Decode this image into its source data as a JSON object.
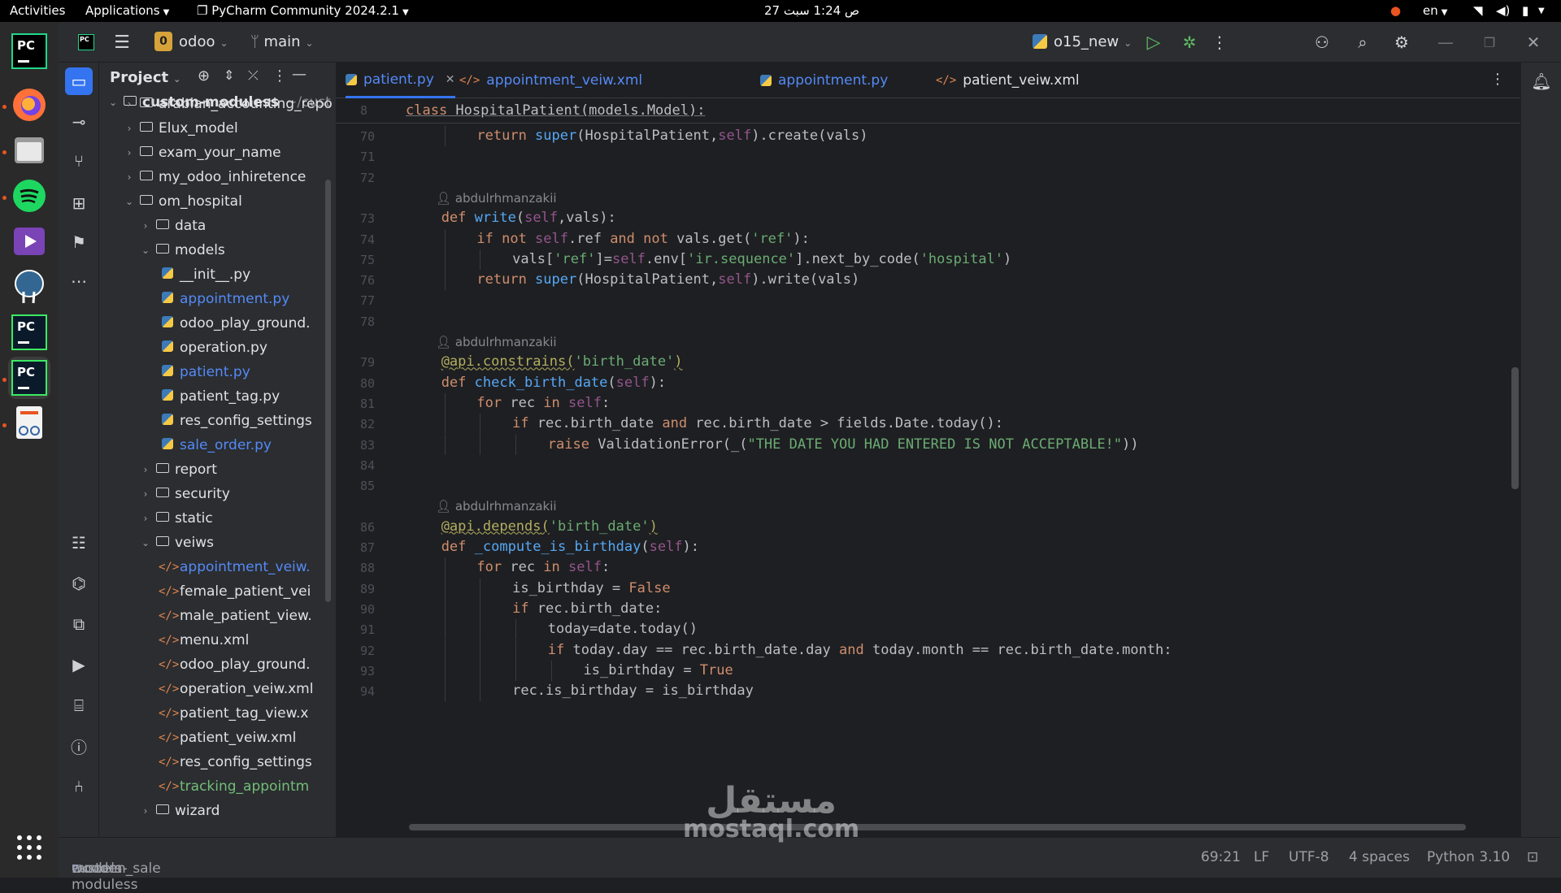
{
  "topbar": {
    "activities": "Activities",
    "applications": "Applications",
    "window_app": "PyCharm Community 2024.2.1",
    "clock": "ص 1:24  سبت 27",
    "lang": "en"
  },
  "toolbar": {
    "project_badge": "0",
    "project_name": "odoo",
    "branch": "main",
    "run_config": "o15_new"
  },
  "project_panel": {
    "title": "Project",
    "root_name": "custom-moduless",
    "root_path": "~/cust",
    "items": [
      {
        "label": "arabian_accounting_repo",
        "kind": "module"
      },
      {
        "label": "Elux_model",
        "kind": "module"
      },
      {
        "label": "exam_your_name",
        "kind": "module"
      },
      {
        "label": "my_odoo_inhiretence",
        "kind": "module"
      },
      {
        "label": "om_hospital",
        "kind": "module"
      },
      {
        "label": "data",
        "kind": "dir"
      },
      {
        "label": "models",
        "kind": "dir"
      },
      {
        "label": "__init__.py",
        "kind": "py"
      },
      {
        "label": "appointment.py",
        "kind": "py"
      },
      {
        "label": "odoo_play_ground.",
        "kind": "py"
      },
      {
        "label": "operation.py",
        "kind": "py"
      },
      {
        "label": "patient.py",
        "kind": "py"
      },
      {
        "label": "patient_tag.py",
        "kind": "py"
      },
      {
        "label": "res_config_settings",
        "kind": "py"
      },
      {
        "label": "sale_order.py",
        "kind": "py"
      },
      {
        "label": "report",
        "kind": "dir"
      },
      {
        "label": "security",
        "kind": "dir"
      },
      {
        "label": "static",
        "kind": "dir"
      },
      {
        "label": "veiws",
        "kind": "dir"
      },
      {
        "label": "appointment_veiw.",
        "kind": "xml"
      },
      {
        "label": "female_patient_vei",
        "kind": "xml"
      },
      {
        "label": "male_patient_view.",
        "kind": "xml"
      },
      {
        "label": "menu.xml",
        "kind": "xml"
      },
      {
        "label": "odoo_play_ground.",
        "kind": "xml"
      },
      {
        "label": "operation_veiw.xml",
        "kind": "xml"
      },
      {
        "label": "patient_tag_view.x",
        "kind": "xml"
      },
      {
        "label": "patient_veiw.xml",
        "kind": "xml"
      },
      {
        "label": "res_config_settings",
        "kind": "xml"
      },
      {
        "label": "tracking_appointm",
        "kind": "xml"
      },
      {
        "label": "wizard",
        "kind": "dir"
      }
    ]
  },
  "tabs": [
    {
      "label": "patient.py",
      "icon": "python-icon"
    },
    {
      "label": "appointment_veiw.xml",
      "icon": "xml-icon"
    },
    {
      "label": "appointment.py",
      "icon": "python-icon"
    },
    {
      "label": "patient_veiw.xml",
      "icon": "xml-icon"
    }
  ],
  "editor": {
    "sticky_line_number": "8",
    "sticky_class_kw": "class",
    "sticky_class_rest": " HospitalPatient(models.Model):",
    "author": "abdulrhmanzakii",
    "line_numbers": [
      "70",
      "71",
      "72",
      "73",
      "74",
      "75",
      "76",
      "77",
      "78",
      "79",
      "80",
      "81",
      "82",
      "83",
      "84",
      "85",
      "86",
      "87",
      "88",
      "89",
      "90",
      "91",
      "92",
      "93",
      "94"
    ]
  },
  "status": {
    "crumb_1": "custom-moduless",
    "crumb_2": "wooden_sale",
    "crumb_3": "models",
    "position": "69:21",
    "line_sep": "LF",
    "encoding": "UTF-8",
    "indent": "4 spaces",
    "interpreter": "Python 3.10"
  },
  "watermark": {
    "arabic": "مستقل",
    "latin": "mostaql.com"
  },
  "colors": {
    "accent": "#3574f0",
    "keyword": "#cf8e6d",
    "function": "#56a8f5",
    "string": "#6aab73",
    "self": "#94558d"
  }
}
